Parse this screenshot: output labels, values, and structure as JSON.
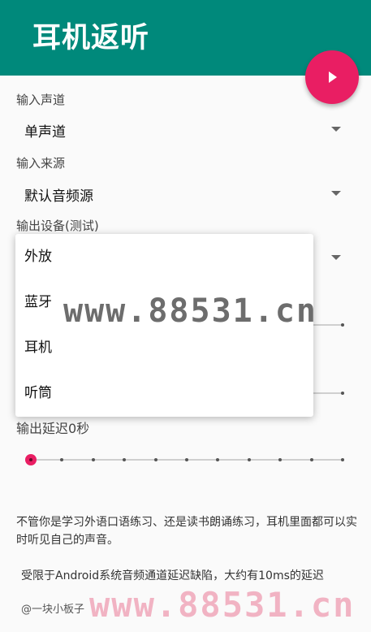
{
  "appbar": {
    "title": "耳机返听"
  },
  "fab": {
    "icon": "play-icon"
  },
  "input_channel": {
    "label": "输入声道",
    "value": "单声道"
  },
  "input_source": {
    "label": "输入来源",
    "value": "默认音频源"
  },
  "output_device": {
    "label": "输出设备(测试)",
    "options": [
      "外放",
      "蓝牙",
      "耳机",
      "听筒"
    ]
  },
  "output_delay": {
    "label": "输出延迟0秒",
    "level_fraction": 0.0
  },
  "description": "不管你是学习外语口语练习、还是读书朗诵练习，耳机里面都可以实时听见自己的声音。",
  "note": "受限于Android系统音频通道延迟缺陷，大约有10ms的延迟",
  "author": "@一块小板子",
  "watermarks": [
    "www.88531.cn",
    "www.88531.cn"
  ],
  "colors": {
    "appbar": "#00897b",
    "accent": "#e91e63"
  }
}
